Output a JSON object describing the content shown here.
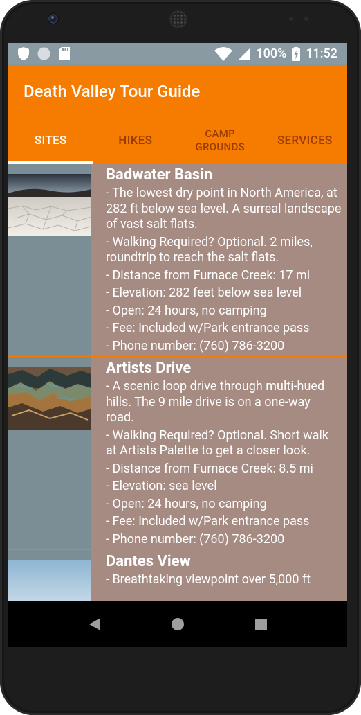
{
  "status_bar": {
    "battery": "100%",
    "time": "11:52"
  },
  "app": {
    "title": "Death Valley Tour Guide"
  },
  "tabs": [
    {
      "label": "SITES",
      "active": true
    },
    {
      "label": "HIKES",
      "active": false
    },
    {
      "label": "CAMP GROUNDS",
      "active": false
    },
    {
      "label": "SERVICES",
      "active": false
    }
  ],
  "sites": [
    {
      "title": "Badwater Basin",
      "lines": [
        "- The lowest dry point in North America, at 282 ft below sea level.  A surreal landscape of vast salt flats.",
        "- Walking Required? Optional. 2 miles, roundtrip to reach the salt flats.",
        "- Distance from Furnace Creek: 17 mi",
        "- Elevation: 282 feet below sea level",
        "- Open: 24 hours, no camping",
        "- Fee: Included w/Park entrance pass",
        "- Phone number: (760) 786-3200"
      ]
    },
    {
      "title": "Artists Drive",
      "lines": [
        "- A scenic loop drive through multi-hued hills.  The 9 mile drive is on a one-way road.",
        "- Walking Required?  Optional.  Short walk at Artists Palette to get a closer look.",
        "- Distance from Furnace Creek: 8.5 mi",
        "- Elevation: sea level",
        "- Open: 24 hours, no camping",
        "- Fee: Included w/Park entrance pass",
        "- Phone number: (760) 786-3200"
      ]
    },
    {
      "title": "Dantes View",
      "lines": [
        "- Breathtaking viewpoint over 5,000 ft"
      ]
    }
  ],
  "colors": {
    "primary": "#f57c00",
    "item_bg": "#a68b83",
    "thumb_bg": "#7b8d95",
    "status_bar": "#8a9aa3"
  }
}
